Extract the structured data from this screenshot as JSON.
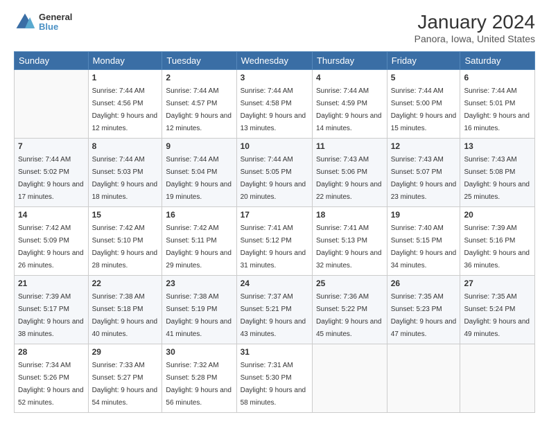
{
  "logo": {
    "line1": "General",
    "line2": "Blue"
  },
  "title": "January 2024",
  "subtitle": "Panora, Iowa, United States",
  "days_header": [
    "Sunday",
    "Monday",
    "Tuesday",
    "Wednesday",
    "Thursday",
    "Friday",
    "Saturday"
  ],
  "weeks": [
    [
      {
        "num": "",
        "sunrise": "",
        "sunset": "",
        "daylight": ""
      },
      {
        "num": "1",
        "sunrise": "Sunrise: 7:44 AM",
        "sunset": "Sunset: 4:56 PM",
        "daylight": "Daylight: 9 hours and 12 minutes."
      },
      {
        "num": "2",
        "sunrise": "Sunrise: 7:44 AM",
        "sunset": "Sunset: 4:57 PM",
        "daylight": "Daylight: 9 hours and 12 minutes."
      },
      {
        "num": "3",
        "sunrise": "Sunrise: 7:44 AM",
        "sunset": "Sunset: 4:58 PM",
        "daylight": "Daylight: 9 hours and 13 minutes."
      },
      {
        "num": "4",
        "sunrise": "Sunrise: 7:44 AM",
        "sunset": "Sunset: 4:59 PM",
        "daylight": "Daylight: 9 hours and 14 minutes."
      },
      {
        "num": "5",
        "sunrise": "Sunrise: 7:44 AM",
        "sunset": "Sunset: 5:00 PM",
        "daylight": "Daylight: 9 hours and 15 minutes."
      },
      {
        "num": "6",
        "sunrise": "Sunrise: 7:44 AM",
        "sunset": "Sunset: 5:01 PM",
        "daylight": "Daylight: 9 hours and 16 minutes."
      }
    ],
    [
      {
        "num": "7",
        "sunrise": "Sunrise: 7:44 AM",
        "sunset": "Sunset: 5:02 PM",
        "daylight": "Daylight: 9 hours and 17 minutes."
      },
      {
        "num": "8",
        "sunrise": "Sunrise: 7:44 AM",
        "sunset": "Sunset: 5:03 PM",
        "daylight": "Daylight: 9 hours and 18 minutes."
      },
      {
        "num": "9",
        "sunrise": "Sunrise: 7:44 AM",
        "sunset": "Sunset: 5:04 PM",
        "daylight": "Daylight: 9 hours and 19 minutes."
      },
      {
        "num": "10",
        "sunrise": "Sunrise: 7:44 AM",
        "sunset": "Sunset: 5:05 PM",
        "daylight": "Daylight: 9 hours and 20 minutes."
      },
      {
        "num": "11",
        "sunrise": "Sunrise: 7:43 AM",
        "sunset": "Sunset: 5:06 PM",
        "daylight": "Daylight: 9 hours and 22 minutes."
      },
      {
        "num": "12",
        "sunrise": "Sunrise: 7:43 AM",
        "sunset": "Sunset: 5:07 PM",
        "daylight": "Daylight: 9 hours and 23 minutes."
      },
      {
        "num": "13",
        "sunrise": "Sunrise: 7:43 AM",
        "sunset": "Sunset: 5:08 PM",
        "daylight": "Daylight: 9 hours and 25 minutes."
      }
    ],
    [
      {
        "num": "14",
        "sunrise": "Sunrise: 7:42 AM",
        "sunset": "Sunset: 5:09 PM",
        "daylight": "Daylight: 9 hours and 26 minutes."
      },
      {
        "num": "15",
        "sunrise": "Sunrise: 7:42 AM",
        "sunset": "Sunset: 5:10 PM",
        "daylight": "Daylight: 9 hours and 28 minutes."
      },
      {
        "num": "16",
        "sunrise": "Sunrise: 7:42 AM",
        "sunset": "Sunset: 5:11 PM",
        "daylight": "Daylight: 9 hours and 29 minutes."
      },
      {
        "num": "17",
        "sunrise": "Sunrise: 7:41 AM",
        "sunset": "Sunset: 5:12 PM",
        "daylight": "Daylight: 9 hours and 31 minutes."
      },
      {
        "num": "18",
        "sunrise": "Sunrise: 7:41 AM",
        "sunset": "Sunset: 5:13 PM",
        "daylight": "Daylight: 9 hours and 32 minutes."
      },
      {
        "num": "19",
        "sunrise": "Sunrise: 7:40 AM",
        "sunset": "Sunset: 5:15 PM",
        "daylight": "Daylight: 9 hours and 34 minutes."
      },
      {
        "num": "20",
        "sunrise": "Sunrise: 7:39 AM",
        "sunset": "Sunset: 5:16 PM",
        "daylight": "Daylight: 9 hours and 36 minutes."
      }
    ],
    [
      {
        "num": "21",
        "sunrise": "Sunrise: 7:39 AM",
        "sunset": "Sunset: 5:17 PM",
        "daylight": "Daylight: 9 hours and 38 minutes."
      },
      {
        "num": "22",
        "sunrise": "Sunrise: 7:38 AM",
        "sunset": "Sunset: 5:18 PM",
        "daylight": "Daylight: 9 hours and 40 minutes."
      },
      {
        "num": "23",
        "sunrise": "Sunrise: 7:38 AM",
        "sunset": "Sunset: 5:19 PM",
        "daylight": "Daylight: 9 hours and 41 minutes."
      },
      {
        "num": "24",
        "sunrise": "Sunrise: 7:37 AM",
        "sunset": "Sunset: 5:21 PM",
        "daylight": "Daylight: 9 hours and 43 minutes."
      },
      {
        "num": "25",
        "sunrise": "Sunrise: 7:36 AM",
        "sunset": "Sunset: 5:22 PM",
        "daylight": "Daylight: 9 hours and 45 minutes."
      },
      {
        "num": "26",
        "sunrise": "Sunrise: 7:35 AM",
        "sunset": "Sunset: 5:23 PM",
        "daylight": "Daylight: 9 hours and 47 minutes."
      },
      {
        "num": "27",
        "sunrise": "Sunrise: 7:35 AM",
        "sunset": "Sunset: 5:24 PM",
        "daylight": "Daylight: 9 hours and 49 minutes."
      }
    ],
    [
      {
        "num": "28",
        "sunrise": "Sunrise: 7:34 AM",
        "sunset": "Sunset: 5:26 PM",
        "daylight": "Daylight: 9 hours and 52 minutes."
      },
      {
        "num": "29",
        "sunrise": "Sunrise: 7:33 AM",
        "sunset": "Sunset: 5:27 PM",
        "daylight": "Daylight: 9 hours and 54 minutes."
      },
      {
        "num": "30",
        "sunrise": "Sunrise: 7:32 AM",
        "sunset": "Sunset: 5:28 PM",
        "daylight": "Daylight: 9 hours and 56 minutes."
      },
      {
        "num": "31",
        "sunrise": "Sunrise: 7:31 AM",
        "sunset": "Sunset: 5:30 PM",
        "daylight": "Daylight: 9 hours and 58 minutes."
      },
      {
        "num": "",
        "sunrise": "",
        "sunset": "",
        "daylight": ""
      },
      {
        "num": "",
        "sunrise": "",
        "sunset": "",
        "daylight": ""
      },
      {
        "num": "",
        "sunrise": "",
        "sunset": "",
        "daylight": ""
      }
    ]
  ]
}
